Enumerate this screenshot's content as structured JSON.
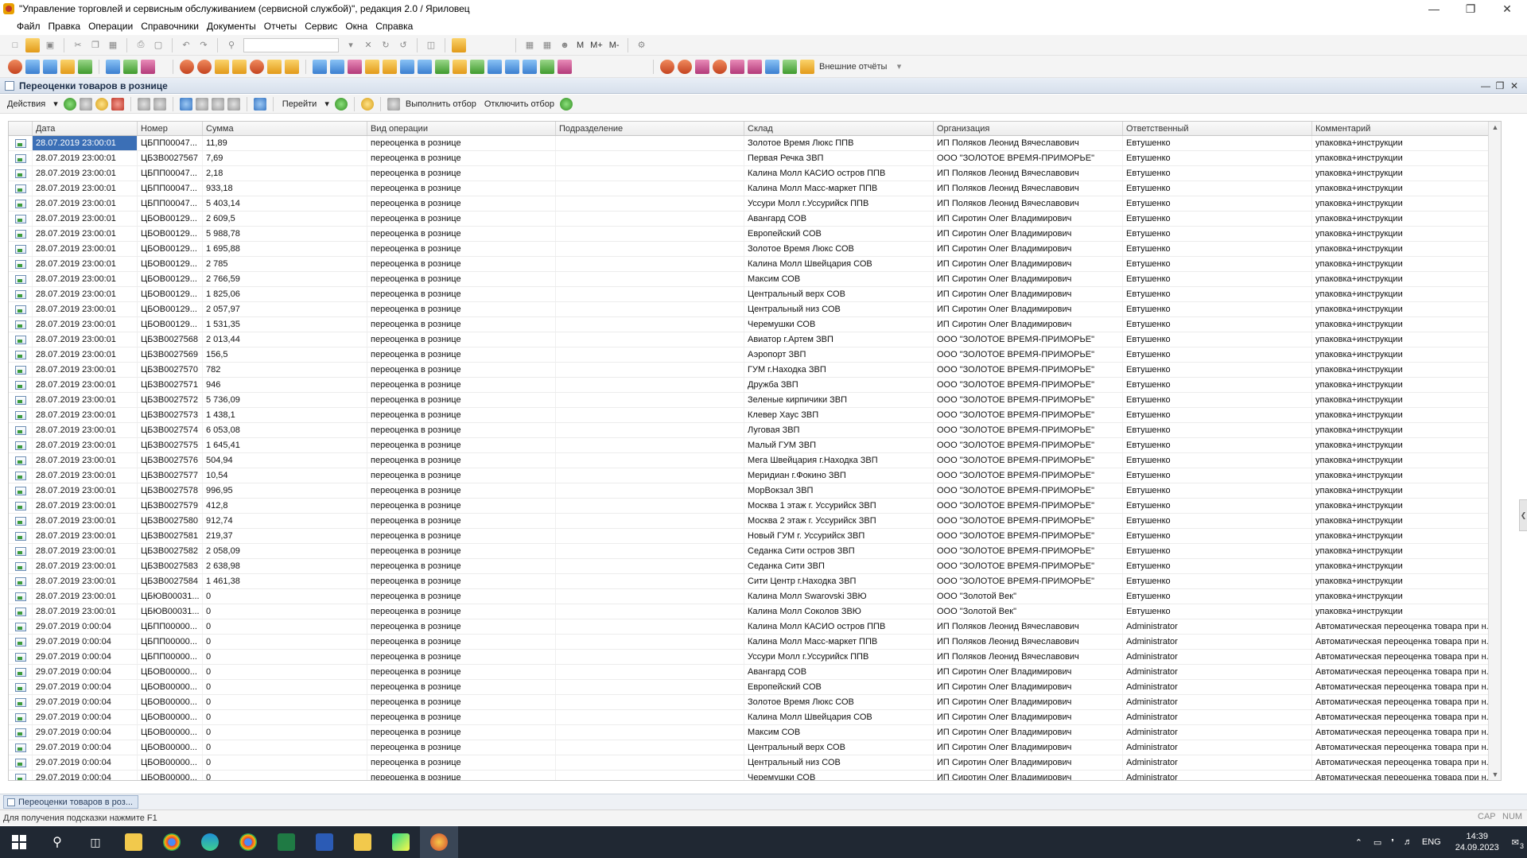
{
  "window": {
    "title": "\"Управление торговлей и сервисным обслуживанием (сервисной службой)\", редакция 2.0 / Яриловец"
  },
  "menu": [
    "Файл",
    "Правка",
    "Операции",
    "Справочники",
    "Документы",
    "Отчеты",
    "Сервис",
    "Окна",
    "Справка"
  ],
  "toolbar": {
    "m_label": "M",
    "mplus_label": "M+",
    "mminus_label": "M-",
    "external_reports": "Внешние отчёты"
  },
  "doc": {
    "title": "Переоценки товаров в рознице",
    "toolbar": {
      "actions": "Действия",
      "goto": "Перейти",
      "apply_filter": "Выполнить отбор",
      "disable_filter": "Отключить отбор"
    },
    "columns": [
      "Дата",
      "Номер",
      "Сумма",
      "Вид операции",
      "Подразделение",
      "Склад",
      "Организация",
      "Ответственный",
      "Комментарий"
    ],
    "rows": [
      [
        "28.07.2019 23:00:01",
        "ЦБПП00047...",
        "11,89",
        "переоценка в рознице",
        "",
        "Золотое Время Люкс ППВ",
        "ИП Поляков Леонид Вячеславович",
        "Евтушенко",
        "упаковка+инструкции"
      ],
      [
        "28.07.2019 23:00:01",
        "ЦБЗВ0027567",
        "7,69",
        "переоценка в рознице",
        "",
        "Первая Речка ЗВП",
        "ООО \"ЗОЛОТОЕ ВРЕМЯ-ПРИМОРЬЕ\"",
        "Евтушенко",
        "упаковка+инструкции"
      ],
      [
        "28.07.2019 23:00:01",
        "ЦБПП00047...",
        "2,18",
        "переоценка в рознице",
        "",
        "Калина Молл КАСИО остров ППВ",
        "ИП Поляков Леонид Вячеславович",
        "Евтушенко",
        "упаковка+инструкции"
      ],
      [
        "28.07.2019 23:00:01",
        "ЦБПП00047...",
        "933,18",
        "переоценка в рознице",
        "",
        "Калина Молл Масс-маркет ППВ",
        "ИП Поляков Леонид Вячеславович",
        "Евтушенко",
        "упаковка+инструкции"
      ],
      [
        "28.07.2019 23:00:01",
        "ЦБПП00047...",
        "5 403,14",
        "переоценка в рознице",
        "",
        "Уссури Молл г.Уссурийск ППВ",
        "ИП Поляков Леонид Вячеславович",
        "Евтушенко",
        "упаковка+инструкции"
      ],
      [
        "28.07.2019 23:00:01",
        "ЦБОВ00129...",
        "2 609,5",
        "переоценка в рознице",
        "",
        "Авангард СОВ",
        "ИП Сиротин Олег Владимирович",
        "Евтушенко",
        "упаковка+инструкции"
      ],
      [
        "28.07.2019 23:00:01",
        "ЦБОВ00129...",
        "5 988,78",
        "переоценка в рознице",
        "",
        "Европейский СОВ",
        "ИП Сиротин Олег Владимирович",
        "Евтушенко",
        "упаковка+инструкции"
      ],
      [
        "28.07.2019 23:00:01",
        "ЦБОВ00129...",
        "1 695,88",
        "переоценка в рознице",
        "",
        "Золотое Время Люкс СОВ",
        "ИП Сиротин Олег Владимирович",
        "Евтушенко",
        "упаковка+инструкции"
      ],
      [
        "28.07.2019 23:00:01",
        "ЦБОВ00129...",
        "2 785",
        "переоценка в рознице",
        "",
        "Калина Молл Швейцария СОВ",
        "ИП Сиротин Олег Владимирович",
        "Евтушенко",
        "упаковка+инструкции"
      ],
      [
        "28.07.2019 23:00:01",
        "ЦБОВ00129...",
        "2 766,59",
        "переоценка в рознице",
        "",
        "Максим СОВ",
        "ИП Сиротин Олег Владимирович",
        "Евтушенко",
        "упаковка+инструкции"
      ],
      [
        "28.07.2019 23:00:01",
        "ЦБОВ00129...",
        "1 825,06",
        "переоценка в рознице",
        "",
        "Центральный верх СОВ",
        "ИП Сиротин Олег Владимирович",
        "Евтушенко",
        "упаковка+инструкции"
      ],
      [
        "28.07.2019 23:00:01",
        "ЦБОВ00129...",
        "2 057,97",
        "переоценка в рознице",
        "",
        "Центральный низ СОВ",
        "ИП Сиротин Олег Владимирович",
        "Евтушенко",
        "упаковка+инструкции"
      ],
      [
        "28.07.2019 23:00:01",
        "ЦБОВ00129...",
        "1 531,35",
        "переоценка в рознице",
        "",
        "Черемушки СОВ",
        "ИП Сиротин Олег Владимирович",
        "Евтушенко",
        "упаковка+инструкции"
      ],
      [
        "28.07.2019 23:00:01",
        "ЦБЗВ0027568",
        "2 013,44",
        "переоценка в рознице",
        "",
        "Авиатор г.Артем ЗВП",
        "ООО \"ЗОЛОТОЕ ВРЕМЯ-ПРИМОРЬЕ\"",
        "Евтушенко",
        "упаковка+инструкции"
      ],
      [
        "28.07.2019 23:00:01",
        "ЦБЗВ0027569",
        "156,5",
        "переоценка в рознице",
        "",
        "Аэропорт ЗВП",
        "ООО \"ЗОЛОТОЕ ВРЕМЯ-ПРИМОРЬЕ\"",
        "Евтушенко",
        "упаковка+инструкции"
      ],
      [
        "28.07.2019 23:00:01",
        "ЦБЗВ0027570",
        "782",
        "переоценка в рознице",
        "",
        "ГУМ г.Находка ЗВП",
        "ООО \"ЗОЛОТОЕ ВРЕМЯ-ПРИМОРЬЕ\"",
        "Евтушенко",
        "упаковка+инструкции"
      ],
      [
        "28.07.2019 23:00:01",
        "ЦБЗВ0027571",
        "946",
        "переоценка в рознице",
        "",
        "Дружба ЗВП",
        "ООО \"ЗОЛОТОЕ ВРЕМЯ-ПРИМОРЬЕ\"",
        "Евтушенко",
        "упаковка+инструкции"
      ],
      [
        "28.07.2019 23:00:01",
        "ЦБЗВ0027572",
        "5 736,09",
        "переоценка в рознице",
        "",
        "Зеленые кирпичики ЗВП",
        "ООО \"ЗОЛОТОЕ ВРЕМЯ-ПРИМОРЬЕ\"",
        "Евтушенко",
        "упаковка+инструкции"
      ],
      [
        "28.07.2019 23:00:01",
        "ЦБЗВ0027573",
        "1 438,1",
        "переоценка в рознице",
        "",
        "Клевер Хаус ЗВП",
        "ООО \"ЗОЛОТОЕ ВРЕМЯ-ПРИМОРЬЕ\"",
        "Евтушенко",
        "упаковка+инструкции"
      ],
      [
        "28.07.2019 23:00:01",
        "ЦБЗВ0027574",
        "6 053,08",
        "переоценка в рознице",
        "",
        "Луговая ЗВП",
        "ООО \"ЗОЛОТОЕ ВРЕМЯ-ПРИМОРЬЕ\"",
        "Евтушенко",
        "упаковка+инструкции"
      ],
      [
        "28.07.2019 23:00:01",
        "ЦБЗВ0027575",
        "1 645,41",
        "переоценка в рознице",
        "",
        "Малый ГУМ ЗВП",
        "ООО \"ЗОЛОТОЕ ВРЕМЯ-ПРИМОРЬЕ\"",
        "Евтушенко",
        "упаковка+инструкции"
      ],
      [
        "28.07.2019 23:00:01",
        "ЦБЗВ0027576",
        "504,94",
        "переоценка в рознице",
        "",
        "Мега Швейцария г.Находка ЗВП",
        "ООО \"ЗОЛОТОЕ ВРЕМЯ-ПРИМОРЬЕ\"",
        "Евтушенко",
        "упаковка+инструкции"
      ],
      [
        "28.07.2019 23:00:01",
        "ЦБЗВ0027577",
        "10,54",
        "переоценка в рознице",
        "",
        "Меридиан г.Фокино ЗВП",
        "ООО \"ЗОЛОТОЕ ВРЕМЯ-ПРИМОРЬЕ\"",
        "Евтушенко",
        "упаковка+инструкции"
      ],
      [
        "28.07.2019 23:00:01",
        "ЦБЗВ0027578",
        "996,95",
        "переоценка в рознице",
        "",
        "МорВокзал ЗВП",
        "ООО \"ЗОЛОТОЕ ВРЕМЯ-ПРИМОРЬЕ\"",
        "Евтушенко",
        "упаковка+инструкции"
      ],
      [
        "28.07.2019 23:00:01",
        "ЦБЗВ0027579",
        "412,8",
        "переоценка в рознице",
        "",
        "Москва 1 этаж г. Уссурийск ЗВП",
        "ООО \"ЗОЛОТОЕ ВРЕМЯ-ПРИМОРЬЕ\"",
        "Евтушенко",
        "упаковка+инструкции"
      ],
      [
        "28.07.2019 23:00:01",
        "ЦБЗВ0027580",
        "912,74",
        "переоценка в рознице",
        "",
        "Москва 2 этаж г. Уссурийск ЗВП",
        "ООО \"ЗОЛОТОЕ ВРЕМЯ-ПРИМОРЬЕ\"",
        "Евтушенко",
        "упаковка+инструкции"
      ],
      [
        "28.07.2019 23:00:01",
        "ЦБЗВ0027581",
        "219,37",
        "переоценка в рознице",
        "",
        "Новый ГУМ г. Уссурийск ЗВП",
        "ООО \"ЗОЛОТОЕ ВРЕМЯ-ПРИМОРЬЕ\"",
        "Евтушенко",
        "упаковка+инструкции"
      ],
      [
        "28.07.2019 23:00:01",
        "ЦБЗВ0027582",
        "2 058,09",
        "переоценка в рознице",
        "",
        "Седанка Сити остров ЗВП",
        "ООО \"ЗОЛОТОЕ ВРЕМЯ-ПРИМОРЬЕ\"",
        "Евтушенко",
        "упаковка+инструкции"
      ],
      [
        "28.07.2019 23:00:01",
        "ЦБЗВ0027583",
        "2 638,98",
        "переоценка в рознице",
        "",
        "Седанка Сити ЗВП",
        "ООО \"ЗОЛОТОЕ ВРЕМЯ-ПРИМОРЬЕ\"",
        "Евтушенко",
        "упаковка+инструкции"
      ],
      [
        "28.07.2019 23:00:01",
        "ЦБЗВ0027584",
        "1 461,38",
        "переоценка в рознице",
        "",
        "Сити Центр г.Находка ЗВП",
        "ООО \"ЗОЛОТОЕ ВРЕМЯ-ПРИМОРЬЕ\"",
        "Евтушенко",
        "упаковка+инструкции"
      ],
      [
        "28.07.2019 23:00:01",
        "ЦБЮВ00031...",
        "0",
        "переоценка в рознице",
        "",
        "Калина Молл Swarovski ЗВЮ",
        "ООО \"Золотой Век\"",
        "Евтушенко",
        "упаковка+инструкции"
      ],
      [
        "28.07.2019 23:00:01",
        "ЦБЮВ00031...",
        "0",
        "переоценка в рознице",
        "",
        "Калина Молл Соколов ЗВЮ",
        "ООО \"Золотой Век\"",
        "Евтушенко",
        "упаковка+инструкции"
      ],
      [
        "29.07.2019 0:00:04",
        "ЦБПП00000...",
        "0",
        "переоценка в рознице",
        "",
        "Калина Молл КАСИО остров ППВ",
        "ИП Поляков Леонид Вячеславович",
        "Administrator",
        "Автоматическая переоценка товара при н..."
      ],
      [
        "29.07.2019 0:00:04",
        "ЦБПП00000...",
        "0",
        "переоценка в рознице",
        "",
        "Калина Молл Масс-маркет ППВ",
        "ИП Поляков Леонид Вячеславович",
        "Administrator",
        "Автоматическая переоценка товара при н..."
      ],
      [
        "29.07.2019 0:00:04",
        "ЦБПП00000...",
        "0",
        "переоценка в рознице",
        "",
        "Уссури Молл г.Уссурийск ППВ",
        "ИП Поляков Леонид Вячеславович",
        "Administrator",
        "Автоматическая переоценка товара при н..."
      ],
      [
        "29.07.2019 0:00:04",
        "ЦБОВ00000...",
        "0",
        "переоценка в рознице",
        "",
        "Авангард СОВ",
        "ИП Сиротин Олег Владимирович",
        "Administrator",
        "Автоматическая переоценка товара при н..."
      ],
      [
        "29.07.2019 0:00:04",
        "ЦБОВ00000...",
        "0",
        "переоценка в рознице",
        "",
        "Европейский СОВ",
        "ИП Сиротин Олег Владимирович",
        "Administrator",
        "Автоматическая переоценка товара при н..."
      ],
      [
        "29.07.2019 0:00:04",
        "ЦБОВ00000...",
        "0",
        "переоценка в рознице",
        "",
        "Золотое Время Люкс СОВ",
        "ИП Сиротин Олег Владимирович",
        "Administrator",
        "Автоматическая переоценка товара при н..."
      ],
      [
        "29.07.2019 0:00:04",
        "ЦБОВ00000...",
        "0",
        "переоценка в рознице",
        "",
        "Калина Молл Швейцария СОВ",
        "ИП Сиротин Олег Владимирович",
        "Administrator",
        "Автоматическая переоценка товара при н..."
      ],
      [
        "29.07.2019 0:00:04",
        "ЦБОВ00000...",
        "0",
        "переоценка в рознице",
        "",
        "Максим СОВ",
        "ИП Сиротин Олег Владимирович",
        "Administrator",
        "Автоматическая переоценка товара при н..."
      ],
      [
        "29.07.2019 0:00:04",
        "ЦБОВ00000...",
        "0",
        "переоценка в рознице",
        "",
        "Центральный верх СОВ",
        "ИП Сиротин Олег Владимирович",
        "Administrator",
        "Автоматическая переоценка товара при н..."
      ],
      [
        "29.07.2019 0:00:04",
        "ЦБОВ00000...",
        "0",
        "переоценка в рознице",
        "",
        "Центральный низ СОВ",
        "ИП Сиротин Олег Владимирович",
        "Administrator",
        "Автоматическая переоценка товара при н..."
      ],
      [
        "29.07.2019 0:00:04",
        "ЦБОВ00000...",
        "0",
        "переоценка в рознице",
        "",
        "Черемушки СОВ",
        "ИП Сиротин Олег Владимирович",
        "Administrator",
        "Автоматическая переоценка товара при н..."
      ]
    ]
  },
  "window_tab": "Переоценки товаров в роз...",
  "status": {
    "hint": "Для получения подсказки нажмите F1",
    "cap": "CAP",
    "num": "NUM"
  },
  "taskbar": {
    "lang": "ENG",
    "time": "14:39",
    "date": "24.09.2023",
    "notifications": "3"
  }
}
